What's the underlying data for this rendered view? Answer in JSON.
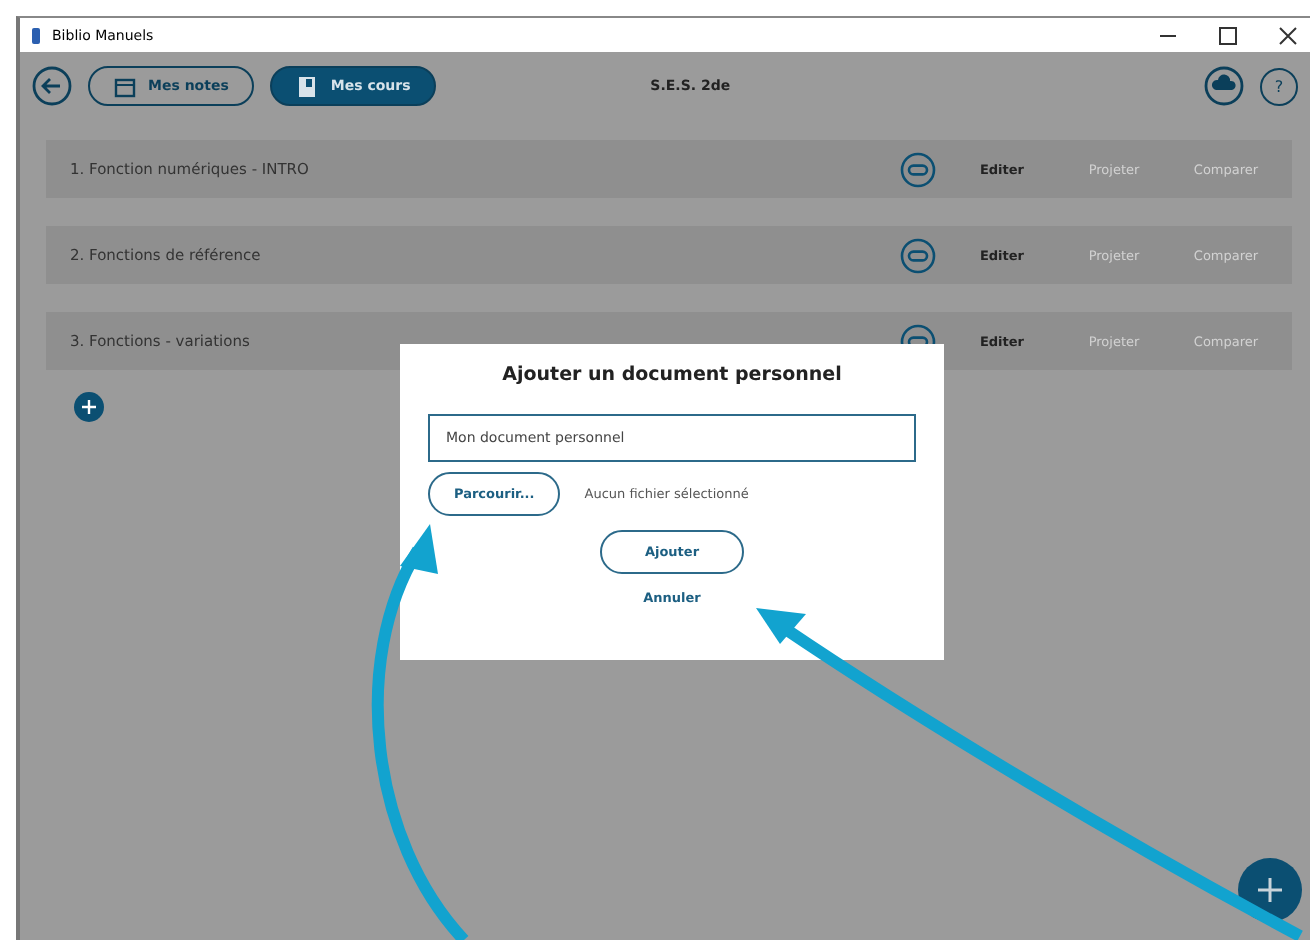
{
  "window": {
    "title": "Biblio Manuels"
  },
  "toolbar": {
    "tabs": [
      {
        "label": "Mes notes",
        "selected": false
      },
      {
        "label": "Mes cours",
        "selected": true
      }
    ],
    "title": "S.E.S. 2de",
    "help_button": "?"
  },
  "courses": [
    {
      "title": "1. Fonction numériques - INTRO",
      "actions": [
        {
          "label": "Editer",
          "disabled": false
        },
        {
          "label": "Projeter",
          "disabled": true
        },
        {
          "label": "Comparer",
          "disabled": true
        }
      ]
    },
    {
      "title": "2. Fonctions de référence",
      "actions": [
        {
          "label": "Editer",
          "disabled": false
        },
        {
          "label": "Projeter",
          "disabled": true
        },
        {
          "label": "Comparer",
          "disabled": true
        }
      ]
    },
    {
      "title": "3. Fonctions - variations",
      "actions": [
        {
          "label": "Editer",
          "disabled": false
        },
        {
          "label": "Projeter",
          "disabled": true
        },
        {
          "label": "Comparer",
          "disabled": true
        }
      ]
    }
  ],
  "dialog": {
    "title": "Ajouter un document personnel",
    "name_field": {
      "value": "Mon document personnel"
    },
    "browse_button": "Parcourir...",
    "file_status": "Aucun fichier sélectionné",
    "submit_button": "Ajouter",
    "cancel_link": "Annuler"
  }
}
